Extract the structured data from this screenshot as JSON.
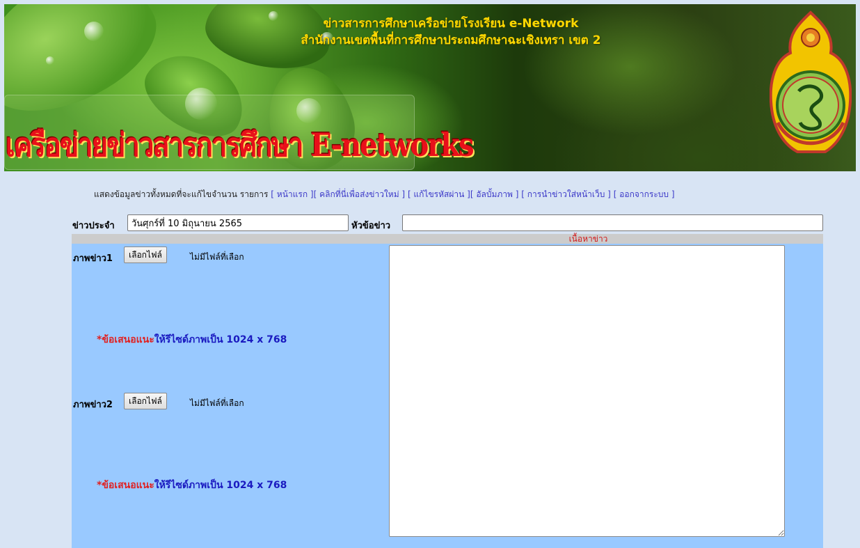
{
  "banner": {
    "title_line1": "ข่าวสารการศึกษาเครือข่ายโรงเรียน e-Network",
    "title_line2": "สำนักงานเขตพื้นที่การศึกษาประถมศึกษาฉะเชิงเทรา เขต 2",
    "logo_text": "เครือข่ายข่าวสารการศึกษา E-networks"
  },
  "nav": {
    "prefix": "แสดงข้อมูลข่าวทั้งหมดที่จะแก้ไขจำนวน รายการ",
    "links": [
      "[ หน้าแรก ]",
      "[ คลิกที่นี่เพื่อส่งข่าวใหม่ ]",
      "[ แก้ไขรหัสผ่าน ]",
      "[ อัลบั้มภาพ ]",
      "[ การนำข่าวใส่หน้าเว็บ ]",
      "[ ออกจากระบบ ]"
    ]
  },
  "form": {
    "date_label": "ข่าวประจำ",
    "date_value": "วันศุกร์ที่ 10 มิถุนายน 2565",
    "headline_label": "หัวข้อข่าว",
    "headline_value": "",
    "content_label": "เนื้อหาข่าว",
    "content_value": "",
    "image1_label": "ภาพข่าว1",
    "image2_label": "ภาพข่าว2",
    "file_button": "เลือกไฟล์",
    "no_file": "ไม่มีไฟล์ที่เลือก",
    "hint_star": "*ข้อเสนอแนะ",
    "hint_text": "ให้รีไซด์ภาพเป็น 1024 x 768"
  },
  "colors": {
    "page_bg": "#d8e4f4",
    "form_bg": "#99c9ff",
    "banner_title": "#ffd700",
    "logo_text": "#e8101a",
    "link": "#3b38c8",
    "hint_red": "#e02020",
    "hint_blue": "#1a1ac0"
  }
}
